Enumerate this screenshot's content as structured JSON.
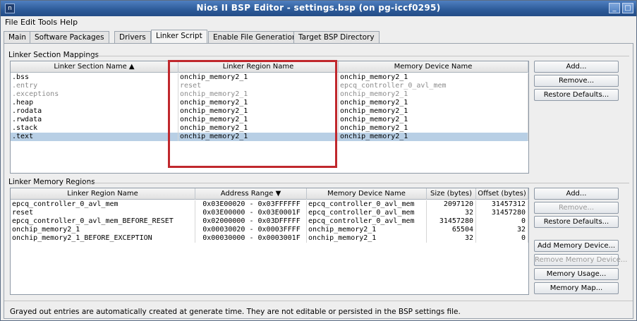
{
  "window": {
    "title": "Nios II BSP Editor - settings.bsp (on pg-iccf0295)",
    "app_icon": "nios-app-icon",
    "controls": {
      "minimize": "_",
      "maximize": "□"
    }
  },
  "menu": [
    "File",
    "Edit",
    "Tools",
    "Help"
  ],
  "tabs": [
    "Main",
    "Software Packages",
    "Drivers",
    "Linker Script",
    "Enable File Generation",
    "Target BSP Directory"
  ],
  "active_tab": "Linker Script",
  "section_mappings": {
    "title": "Linker Section Mappings",
    "columns": [
      "Linker Section Name ▲",
      "Linker Region Name",
      "Memory Device Name"
    ],
    "rows": [
      {
        "section": ".bss",
        "region": "onchip_memory2_1",
        "device": "onchip_memory2_1",
        "grayed": false,
        "selected": false
      },
      {
        "section": ".entry",
        "region": "reset",
        "device": "epcq_controller_0_avl_mem",
        "grayed": true,
        "selected": false
      },
      {
        "section": ".exceptions",
        "region": "onchip_memory2_1",
        "device": "onchip_memory2_1",
        "grayed": true,
        "selected": false
      },
      {
        "section": ".heap",
        "region": "onchip_memory2_1",
        "device": "onchip_memory2_1",
        "grayed": false,
        "selected": false
      },
      {
        "section": ".rodata",
        "region": "onchip_memory2_1",
        "device": "onchip_memory2_1",
        "grayed": false,
        "selected": false
      },
      {
        "section": ".rwdata",
        "region": "onchip_memory2_1",
        "device": "onchip_memory2_1",
        "grayed": false,
        "selected": false
      },
      {
        "section": ".stack",
        "region": "onchip_memory2_1",
        "device": "onchip_memory2_1",
        "grayed": false,
        "selected": false
      },
      {
        "section": ".text",
        "region": "onchip_memory2_1",
        "device": "onchip_memory2_1",
        "grayed": false,
        "selected": true
      }
    ],
    "buttons": {
      "add": "Add...",
      "remove": "Remove...",
      "restore": "Restore Defaults..."
    }
  },
  "memory_regions": {
    "title": "Linker Memory Regions",
    "columns": [
      "Linker Region Name",
      "Address Range ▼",
      "Memory Device Name",
      "Size (bytes)",
      "Offset (bytes)"
    ],
    "rows": [
      {
        "region": "epcq_controller_0_avl_mem",
        "range": "0x03E00020 - 0x03FFFFFF",
        "device": "epcq_controller_0_avl_mem",
        "size": "2097120",
        "offset": "31457312"
      },
      {
        "region": "reset",
        "range": "0x03E00000 - 0x03E0001F",
        "device": "epcq_controller_0_avl_mem",
        "size": "32",
        "offset": "31457280"
      },
      {
        "region": "epcq_controller_0_avl_mem_BEFORE_RESET",
        "range": "0x02000000 - 0x03DFFFFF",
        "device": "epcq_controller_0_avl_mem",
        "size": "31457280",
        "offset": "0"
      },
      {
        "region": "onchip_memory2_1",
        "range": "0x00030020 - 0x0003FFFF",
        "device": "onchip_memory2_1",
        "size": "65504",
        "offset": "32"
      },
      {
        "region": "onchip_memory2_1_BEFORE_EXCEPTION",
        "range": "0x00030000 - 0x0003001F",
        "device": "onchip_memory2_1",
        "size": "32",
        "offset": "0"
      }
    ],
    "buttons": {
      "add": "Add...",
      "remove": "Remove...",
      "restore": "Restore Defaults...",
      "add_device": "Add Memory Device...",
      "remove_device": "Remove Memory Device...",
      "usage": "Memory Usage...",
      "map": "Memory Map..."
    }
  },
  "footer_note": "Grayed out entries are automatically created at generate time. They are not editable or persisted in the BSP settings file.",
  "colors": {
    "highlight": "#c0282d",
    "selection": "#b8cfe5",
    "titlebar": "#2c5a98"
  }
}
